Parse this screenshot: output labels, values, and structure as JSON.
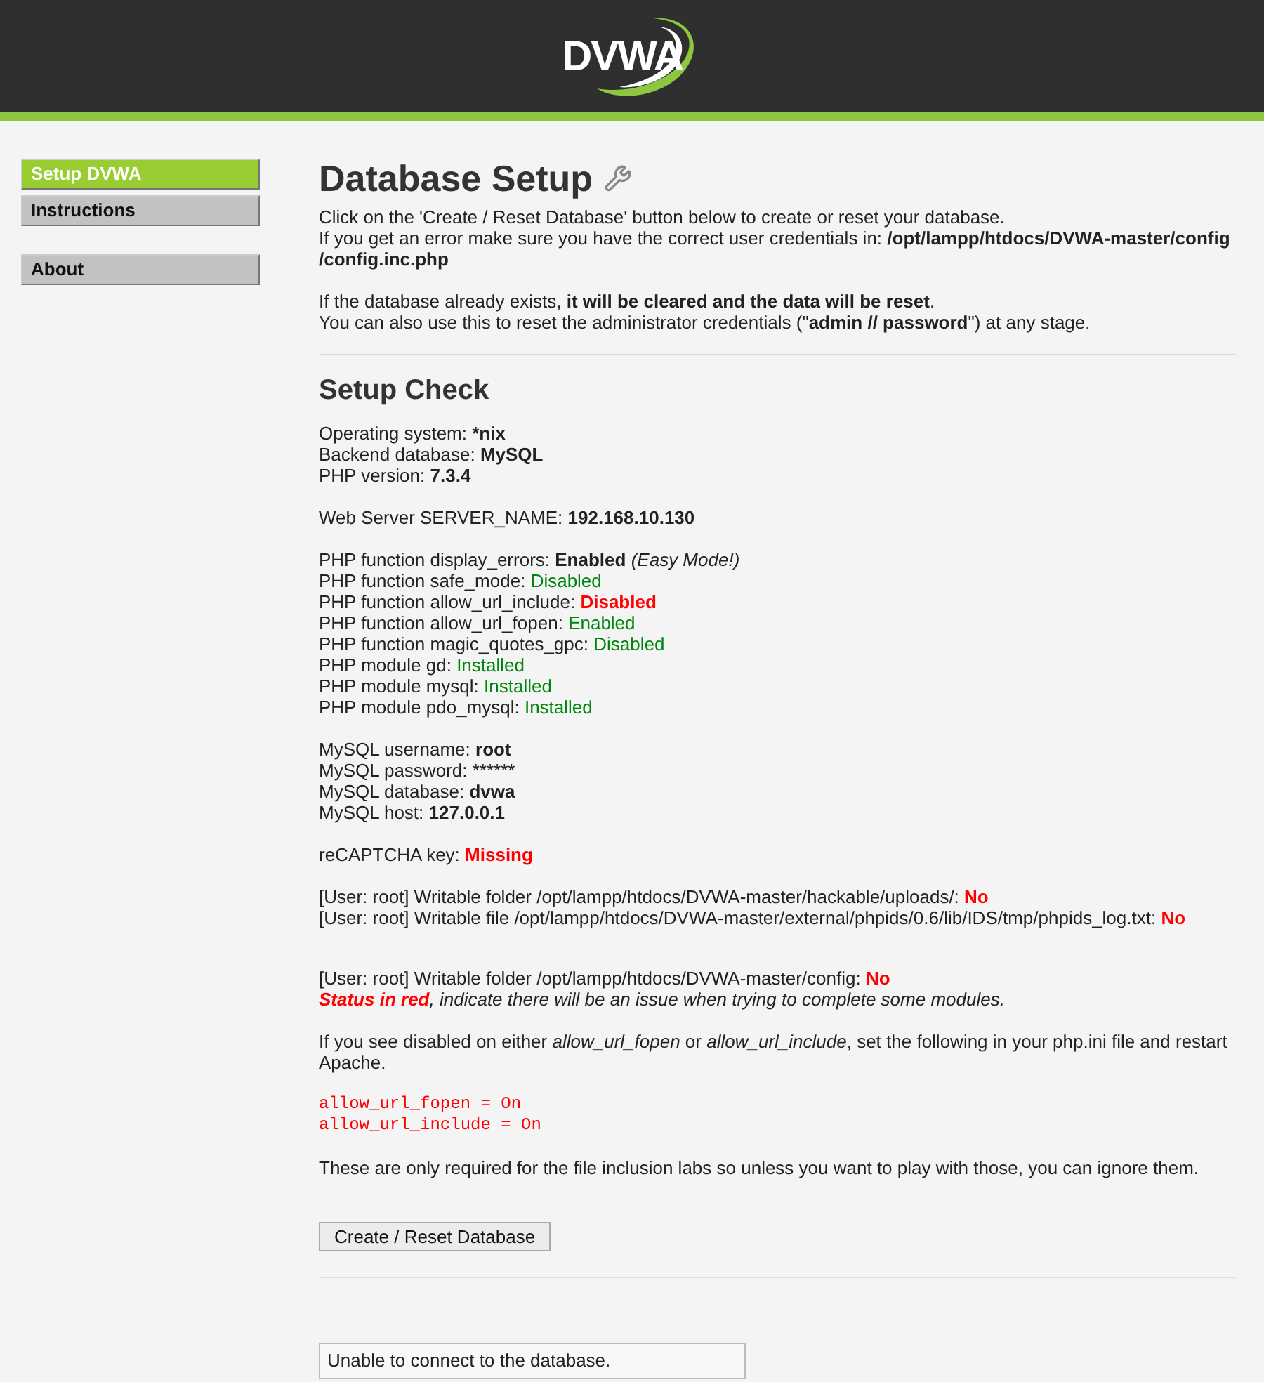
{
  "header": {
    "logo": "DVWA"
  },
  "menu": [
    [
      {
        "label": "Setup DVWA",
        "selected": true
      },
      {
        "label": "Instructions",
        "selected": false
      }
    ],
    [
      {
        "label": "About",
        "selected": false
      }
    ]
  ],
  "page": {
    "title": "Database Setup",
    "intro": [
      [
        "Click on the 'Create / Reset Database' button below to create or reset your database.",
        "If you get an error make sure you have the correct user credentials in: **/opt/lampp/htdocs/DVWA-master/config**",
        "**/config.inc.php**"
      ],
      [
        "If the database already exists, **it will be cleared and the data will be reset**.",
        "You can also use this to reset the administrator credentials (\"**admin // password**\") at any stage."
      ]
    ]
  },
  "setup_check": {
    "title": "Setup Check",
    "groups": [
      [
        {
          "label": "Operating system:",
          "value": "*nix",
          "kind": "bold"
        },
        {
          "label": "Backend database:",
          "value": "MySQL",
          "kind": "bold"
        },
        {
          "label": "PHP version:",
          "value": "7.3.4",
          "kind": "bold"
        }
      ],
      [
        {
          "label": "Web Server SERVER_NAME:",
          "value": "192.168.10.130",
          "kind": "bold"
        }
      ],
      [
        {
          "label": "PHP function display_errors:",
          "value": "Enabled",
          "kind": "bold",
          "note": "(Easy Mode!)"
        },
        {
          "label": "PHP function safe_mode:",
          "value": "Disabled",
          "kind": "ok"
        },
        {
          "label": "PHP function allow_url_include:",
          "value": "Disabled",
          "kind": "bad"
        },
        {
          "label": "PHP function allow_url_fopen:",
          "value": "Enabled",
          "kind": "ok"
        },
        {
          "label": "PHP function magic_quotes_gpc:",
          "value": "Disabled",
          "kind": "ok"
        },
        {
          "label": "PHP module gd:",
          "value": "Installed",
          "kind": "ok"
        },
        {
          "label": "PHP module mysql:",
          "value": "Installed",
          "kind": "ok"
        },
        {
          "label": "PHP module pdo_mysql:",
          "value": "Installed",
          "kind": "ok"
        }
      ],
      [
        {
          "label": "MySQL username:",
          "value": "root",
          "kind": "bold"
        },
        {
          "label": "MySQL password:",
          "value": "******",
          "kind": "plain"
        },
        {
          "label": "MySQL database:",
          "value": "dvwa",
          "kind": "bold"
        },
        {
          "label": "MySQL host:",
          "value": "127.0.0.1",
          "kind": "bold"
        }
      ],
      [
        {
          "label": "reCAPTCHA key:",
          "value": "Missing",
          "kind": "bad"
        }
      ],
      [
        {
          "label": "[User: root] Writable folder /opt/lampp/htdocs/DVWA-master/hackable/uploads/:",
          "value": "No",
          "kind": "bad"
        },
        {
          "label": "[User: root] Writable file /opt/lampp/htdocs/DVWA-master/external/phpids/0.6/lib/IDS/tmp/phpids_log.txt:",
          "value": "No",
          "kind": "bad"
        }
      ],
      [
        {
          "label": "[User: root] Writable folder /opt/lampp/htdocs/DVWA-master/config:",
          "value": "No",
          "kind": "bad"
        }
      ]
    ],
    "warning": {
      "emphasis": "Status in red",
      "rest": ", indicate there will be an issue when trying to complete some modules."
    },
    "hint": "If you see disabled on either *allow_url_fopen* or *allow_url_include*, set the following in your php.ini file and restart Apache.",
    "code": [
      "allow_url_fopen = On",
      "allow_url_include = On"
    ],
    "note": "These are only required for the file inclusion labs so unless you want to play with those, you can ignore them.",
    "button": "Create / Reset Database",
    "message": "Unable to connect to the database."
  }
}
